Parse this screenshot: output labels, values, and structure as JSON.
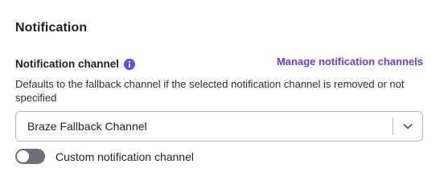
{
  "section": {
    "title": "Notification"
  },
  "notification_channel": {
    "label": "Notification channel",
    "info_icon": "info-icon",
    "manage_link": "Manage notification channels",
    "help_text": "Defaults to the fallback channel if the selected notification channel is removed or not specified",
    "selected_value": "Braze Fallback Channel",
    "dropdown_icon": "chevron-down-icon"
  },
  "custom_toggle": {
    "label": "Custom notification channel",
    "on": false
  },
  "colors": {
    "accent": "#6b3fd6",
    "info_badge": "#5b56d8",
    "toggle_off": "#6f6f7c",
    "border": "#b7b7c2"
  }
}
